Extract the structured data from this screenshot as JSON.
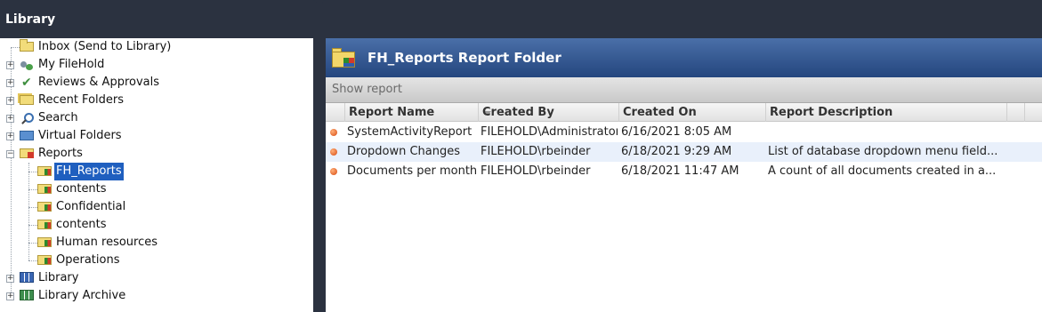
{
  "left_pane": {
    "title": "Library",
    "tree": [
      {
        "label": "Inbox (Send to Library)",
        "icon": "inbox-folder-icon"
      },
      {
        "label": "My FileHold",
        "icon": "my-filehold-icon"
      },
      {
        "label": "Reviews & Approvals",
        "icon": "reviews-approvals-icon"
      },
      {
        "label": "Recent Folders",
        "icon": "recent-folders-icon"
      },
      {
        "label": "Search",
        "icon": "search-icon"
      },
      {
        "label": "Virtual Folders",
        "icon": "virtual-folders-icon"
      },
      {
        "label": "Reports",
        "icon": "reports-icon"
      },
      {
        "label": "FH_Reports",
        "icon": "report-folder-icon"
      },
      {
        "label": "contents",
        "icon": "report-folder-icon"
      },
      {
        "label": "Confidential",
        "icon": "report-folder-icon"
      },
      {
        "label": "contents",
        "icon": "report-folder-icon"
      },
      {
        "label": "Human resources",
        "icon": "report-folder-icon"
      },
      {
        "label": "Operations",
        "icon": "report-folder-icon"
      },
      {
        "label": "Library",
        "icon": "library-icon"
      },
      {
        "label": "Library Archive",
        "icon": "library-archive-icon"
      }
    ]
  },
  "right_pane": {
    "folder_title": "FH_Reports Report Folder",
    "toolbar": {
      "show_report": "Show report"
    },
    "columns": [
      "Report Name",
      "Created By",
      "Created On",
      "Report Description"
    ],
    "rows": [
      {
        "name": "SystemActivityReport",
        "created_by": "FILEHOLD\\Administrator",
        "created_on": "6/16/2021 8:05 AM",
        "description": ""
      },
      {
        "name": "Dropdown Changes",
        "created_by": "FILEHOLD\\rbeinder",
        "created_on": "6/18/2021 9:29 AM",
        "description": "List of database dropdown menu field..."
      },
      {
        "name": "Documents per month",
        "created_by": "FILEHOLD\\rbeinder",
        "created_on": "6/18/2021 11:47 AM",
        "description": "A count of all documents created in a..."
      }
    ]
  },
  "colors": {
    "chrome": "#2b3240",
    "header_blue": "#24467e",
    "selection": "#1f5fbf",
    "alt_row": "#e9f0fb"
  }
}
